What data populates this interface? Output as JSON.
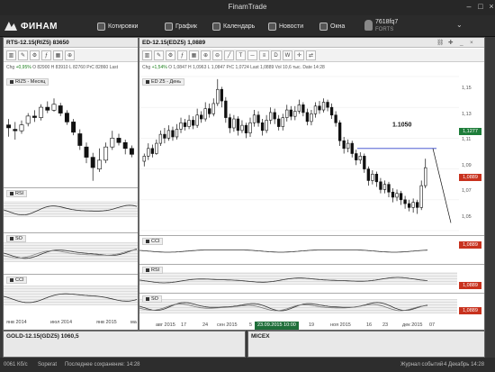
{
  "window": {
    "title": "FinamTrade"
  },
  "toolbar": {
    "logo": "ФИНАМ",
    "items": [
      "Котировки",
      "График",
      "Календарь",
      "Новости",
      "Окна"
    ],
    "account": "7618fq7",
    "account_sub": "FORTS"
  },
  "left_panel": {
    "title": "RTS-12.15(RIZ5) 83650",
    "quote": {
      "chg_label": "Chg",
      "chg": "+0,95%",
      "o_label": "O",
      "o": "82900",
      "h_label": "H",
      "h": "83910",
      "l_label": "L",
      "l": "82760",
      "pc_label": "PrC",
      "pc": "82860",
      "last_label": "Last"
    },
    "legend": "RIZ5 - Месяц",
    "indicators": [
      "RSI",
      "SO",
      "CCI"
    ],
    "x_labels": [
      "янв 2014",
      "июл 2014",
      "янв 2015",
      "ма"
    ],
    "chart_data": {
      "type": "candlestick",
      "series": [
        {
          "name": "RIZ5 - Месяц",
          "ohlc": [
            [
              60,
              58,
              64,
              52
            ],
            [
              57,
              56,
              62,
              50
            ],
            [
              56,
              60,
              63,
              54
            ],
            [
              61,
              66,
              68,
              59
            ],
            [
              66,
              65,
              70,
              62
            ],
            [
              65,
              72,
              74,
              63
            ],
            [
              72,
              70,
              76,
              68
            ],
            [
              70,
              74,
              78,
              69
            ],
            [
              73,
              68,
              75,
              66
            ],
            [
              68,
              62,
              70,
              60
            ],
            [
              62,
              55,
              64,
              53
            ],
            [
              54,
              46,
              57,
              43
            ],
            [
              45,
              38,
              48,
              34
            ],
            [
              38,
              31,
              41,
              22
            ],
            [
              30,
              36,
              44,
              28
            ],
            [
              36,
              45,
              48,
              34
            ],
            [
              45,
              51,
              56,
              43
            ],
            [
              51,
              48,
              54,
              46
            ],
            [
              48,
              44,
              50,
              40
            ],
            [
              44,
              40,
              46,
              38
            ]
          ]
        }
      ]
    }
  },
  "main_panel": {
    "title": "ED-12.15(EDZ5) 1,0889",
    "quote": {
      "chg_label": "Chg",
      "chg": "+1,54%",
      "o_label": "O",
      "o": "1,0847",
      "h_label": "H",
      "h": "1,0963",
      "l_label": "L",
      "l": "1,0847",
      "pc_label": "PrC",
      "pc": "1,0724",
      "last_label": "Last",
      "last": "1,0889",
      "vol_label": "Vol",
      "vol": "10,6 тыс.",
      "date_label": "Date",
      "date": "14:28"
    },
    "legend": "ED Z5 - День",
    "annotation": "1.1050",
    "y_ticks": [
      "1,15",
      "1,13",
      "1,11",
      "1,09",
      "1,07",
      "1,05"
    ],
    "price_tags": [
      "1,1277",
      "1,0889"
    ],
    "indicators": [
      "CCI",
      "RSI",
      "SO"
    ],
    "indicator_tags": [
      "1,0889",
      "1,0889",
      "1,0889"
    ],
    "x_labels": [
      "авг 2015",
      "17",
      "24",
      "сен 2015",
      "5",
      "12",
      "19",
      "ноя 2015",
      "16",
      "23",
      "дек 2015",
      "07"
    ],
    "cursor_date": "23.09.2015 10:00",
    "chart_data": {
      "type": "candlestick",
      "ylim": [
        1.04,
        1.16
      ],
      "y_ticks": [
        1.15,
        1.13,
        1.11,
        1.09,
        1.07,
        1.05
      ],
      "series": [
        {
          "name": "ED Z5 - День",
          "ohlc": [
            [
              1.094,
              1.098,
              1.1,
              1.09
            ],
            [
              1.098,
              1.104,
              1.108,
              1.095
            ],
            [
              1.104,
              1.1,
              1.107,
              1.097
            ],
            [
              1.1,
              1.108,
              1.111,
              1.099
            ],
            [
              1.108,
              1.115,
              1.118,
              1.106
            ],
            [
              1.115,
              1.112,
              1.12,
              1.108
            ],
            [
              1.112,
              1.118,
              1.122,
              1.11
            ],
            [
              1.118,
              1.113,
              1.121,
              1.11
            ],
            [
              1.113,
              1.119,
              1.123,
              1.111
            ],
            [
              1.119,
              1.124,
              1.128,
              1.116
            ],
            [
              1.124,
              1.121,
              1.127,
              1.118
            ],
            [
              1.121,
              1.126,
              1.13,
              1.119
            ],
            [
              1.126,
              1.122,
              1.129,
              1.119
            ],
            [
              1.122,
              1.13,
              1.135,
              1.12
            ],
            [
              1.13,
              1.127,
              1.133,
              1.124
            ],
            [
              1.127,
              1.135,
              1.14,
              1.125
            ],
            [
              1.135,
              1.131,
              1.139,
              1.128
            ],
            [
              1.131,
              1.139,
              1.143,
              1.129
            ],
            [
              1.139,
              1.15,
              1.158,
              1.137
            ],
            [
              1.15,
              1.141,
              1.152,
              1.136
            ],
            [
              1.141,
              1.128,
              1.144,
              1.124
            ],
            [
              1.128,
              1.12,
              1.131,
              1.116
            ],
            [
              1.12,
              1.127,
              1.13,
              1.117
            ],
            [
              1.127,
              1.118,
              1.129,
              1.114
            ],
            [
              1.118,
              1.122,
              1.126,
              1.116
            ],
            [
              1.122,
              1.116,
              1.124,
              1.112
            ],
            [
              1.116,
              1.124,
              1.128,
              1.113
            ],
            [
              1.124,
              1.13,
              1.134,
              1.121
            ],
            [
              1.13,
              1.124,
              1.133,
              1.121
            ],
            [
              1.124,
              1.118,
              1.127,
              1.114
            ],
            [
              1.118,
              1.126,
              1.13,
              1.116
            ],
            [
              1.126,
              1.132,
              1.136,
              1.123
            ],
            [
              1.132,
              1.127,
              1.135,
              1.123
            ],
            [
              1.127,
              1.121,
              1.13,
              1.118
            ],
            [
              1.121,
              1.128,
              1.131,
              1.118
            ],
            [
              1.128,
              1.134,
              1.138,
              1.125
            ],
            [
              1.134,
              1.129,
              1.137,
              1.126
            ],
            [
              1.129,
              1.133,
              1.137,
              1.126
            ],
            [
              1.133,
              1.138,
              1.142,
              1.131
            ],
            [
              1.138,
              1.132,
              1.14,
              1.129
            ],
            [
              1.132,
              1.125,
              1.135,
              1.122
            ],
            [
              1.125,
              1.131,
              1.134,
              1.122
            ],
            [
              1.131,
              1.137,
              1.14,
              1.128
            ],
            [
              1.137,
              1.134,
              1.141,
              1.131
            ],
            [
              1.134,
              1.14,
              1.143,
              1.132
            ],
            [
              1.14,
              1.136,
              1.142,
              1.133
            ],
            [
              1.136,
              1.13,
              1.139,
              1.127
            ],
            [
              1.13,
              1.124,
              1.133,
              1.121
            ],
            [
              1.124,
              1.11,
              1.126,
              1.106
            ],
            [
              1.11,
              1.104,
              1.113,
              1.1
            ],
            [
              1.104,
              1.108,
              1.111,
              1.101
            ],
            [
              1.108,
              1.1,
              1.11,
              1.097
            ],
            [
              1.1,
              1.095,
              1.103,
              1.091
            ],
            [
              1.095,
              1.098,
              1.101,
              1.092
            ],
            [
              1.098,
              1.088,
              1.1,
              1.085
            ],
            [
              1.088,
              1.079,
              1.09,
              1.075
            ],
            [
              1.079,
              1.084,
              1.087,
              1.076
            ],
            [
              1.084,
              1.078,
              1.086,
              1.074
            ],
            [
              1.078,
              1.072,
              1.081,
              1.069
            ],
            [
              1.072,
              1.076,
              1.079,
              1.069
            ],
            [
              1.076,
              1.07,
              1.078,
              1.066
            ],
            [
              1.07,
              1.066,
              1.073,
              1.062
            ],
            [
              1.066,
              1.069,
              1.072,
              1.063
            ],
            [
              1.069,
              1.064,
              1.071,
              1.06
            ],
            [
              1.064,
              1.061,
              1.067,
              1.057
            ],
            [
              1.061,
              1.058,
              1.064,
              1.055
            ],
            [
              1.058,
              1.062,
              1.065,
              1.054
            ],
            [
              1.062,
              1.058,
              1.064,
              1.053
            ],
            [
              1.058,
              1.075,
              1.079,
              1.056
            ],
            [
              1.075,
              1.089,
              1.096,
              1.073
            ]
          ]
        }
      ]
    }
  },
  "bottom": {
    "left_title": "GOLD-12.15(GDZ5) 1060,5",
    "right_title": "MICEX"
  },
  "status": {
    "speed": "0061 Кб/с",
    "server": "Soperat",
    "saved": "Последнее сохранение: 14:28",
    "journal": "Журнал событий",
    "date": "4 Декабрь 14:28"
  },
  "colors": {
    "bull": "#ffffff",
    "bear": "#111111",
    "tag_green": "#1e7d3a",
    "tag_red": "#c8321e",
    "trend": "#3344cc"
  }
}
